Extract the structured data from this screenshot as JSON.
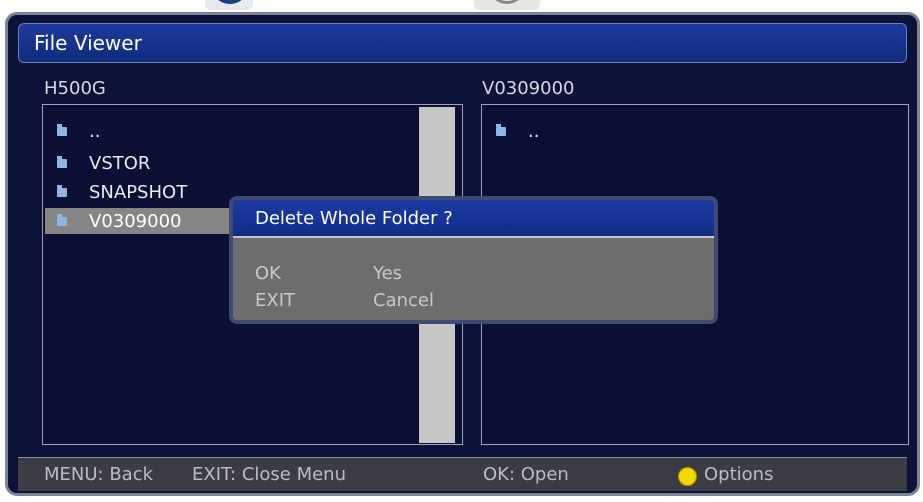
{
  "window": {
    "title": "File Viewer"
  },
  "left_pane": {
    "label": "H500G",
    "items": [
      {
        "name": "..",
        "selected": false
      },
      {
        "name": "VSTOR",
        "selected": false
      },
      {
        "name": "SNAPSHOT",
        "selected": false
      },
      {
        "name": "V0309000",
        "selected": true
      }
    ]
  },
  "right_pane": {
    "label": "V0309000",
    "items": [
      {
        "name": ".."
      }
    ]
  },
  "dialog": {
    "title": "Delete Whole Folder ?",
    "options": [
      {
        "key": "OK",
        "label": "Yes"
      },
      {
        "key": "EXIT",
        "label": "Cancel"
      }
    ]
  },
  "statusbar": {
    "menu": "MENU: Back",
    "exit": "EXIT: Close Menu",
    "ok": "OK: Open",
    "options": "Options",
    "options_color": "#f0d800"
  },
  "icons": {
    "folder": "folder-icon",
    "options_button": "yellow-button-icon"
  }
}
